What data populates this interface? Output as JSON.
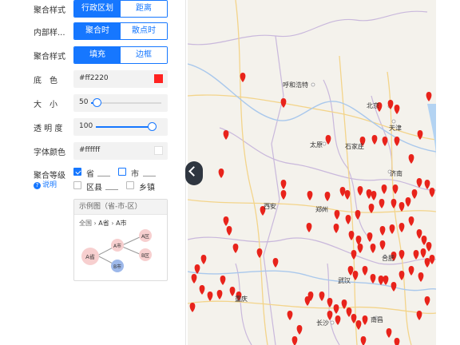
{
  "panel": {
    "rows": [
      {
        "label": "聚合样式",
        "options": [
          "行政区划",
          "距离"
        ],
        "selected": 0
      },
      {
        "label": "内部样...",
        "options": [
          "聚合时",
          "散点时"
        ],
        "selected": 0
      },
      {
        "label": "聚合样式",
        "options": [
          "填充",
          "边框"
        ],
        "selected": 0
      }
    ],
    "bg_color": {
      "label": "底　色",
      "value": "#ff2220",
      "swatch": "#ff2220"
    },
    "size": {
      "label": "大　小",
      "value": "50",
      "level": 0.08
    },
    "opacity": {
      "label": "透 明 度",
      "value": "100",
      "level": 1.0
    },
    "font_color": {
      "label": "字体颜色",
      "value": "#ffffff",
      "swatch": "#ffffff"
    },
    "agg_level": {
      "label": "聚合等级",
      "help": "说明",
      "items": [
        {
          "label": "省",
          "checked": true
        },
        {
          "label": "市",
          "checked": false
        },
        {
          "label": "区县",
          "checked": false
        },
        {
          "label": "乡镇",
          "checked": false
        }
      ]
    },
    "example": {
      "title": "示例图（省-市-区）",
      "crumb_all": "全国",
      "crumb_a": "A省",
      "crumb_b": "A市",
      "nodes": {
        "prov": "A省",
        "city": "A市",
        "city2": "B市",
        "dist_a": "A区",
        "dist_b": "B区"
      }
    }
  },
  "map": {
    "cities": [
      "呼和浩特",
      "北京",
      "天津",
      "太原",
      "石家庄",
      "济南",
      "西安",
      "郑州",
      "武汉",
      "合肥",
      "重庆",
      "长沙",
      "南昌"
    ],
    "marker_color": "#e8231b"
  },
  "colors": {
    "accent": "#1677ff"
  }
}
